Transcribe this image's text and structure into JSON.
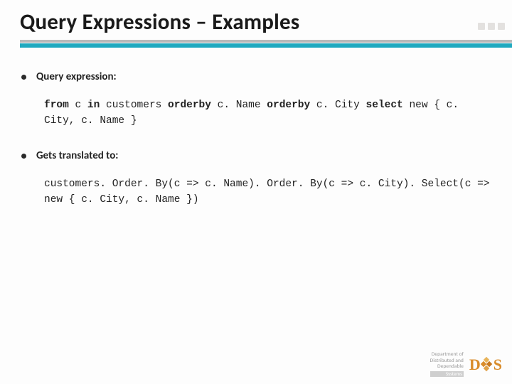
{
  "title": "Query Expressions – Examples",
  "bullets": {
    "b1": "Query expression:",
    "b2": "Gets translated to:"
  },
  "code": {
    "block1_pre_kw1": "from",
    "block1_txt1": " c ",
    "block1_kw2": "in",
    "block1_txt2": " customers ",
    "block1_kw3": "orderby",
    "block1_txt3": " c. Name ",
    "block1_kw4": "orderby",
    "block1_txt4": " c. City ",
    "block1_kw5": "select",
    "block1_txt5": " new { c. City, c. Name }",
    "block2": "customers. Order. By(c => c. Name). Order. By(c => c. City). Select(c => new { c. City, c. Name })"
  },
  "footer": {
    "line1": "Department of",
    "line2": "Distributed and",
    "line3": "Dependable",
    "bar": "Systems",
    "logo_d": "D",
    "logo_s": "S"
  }
}
